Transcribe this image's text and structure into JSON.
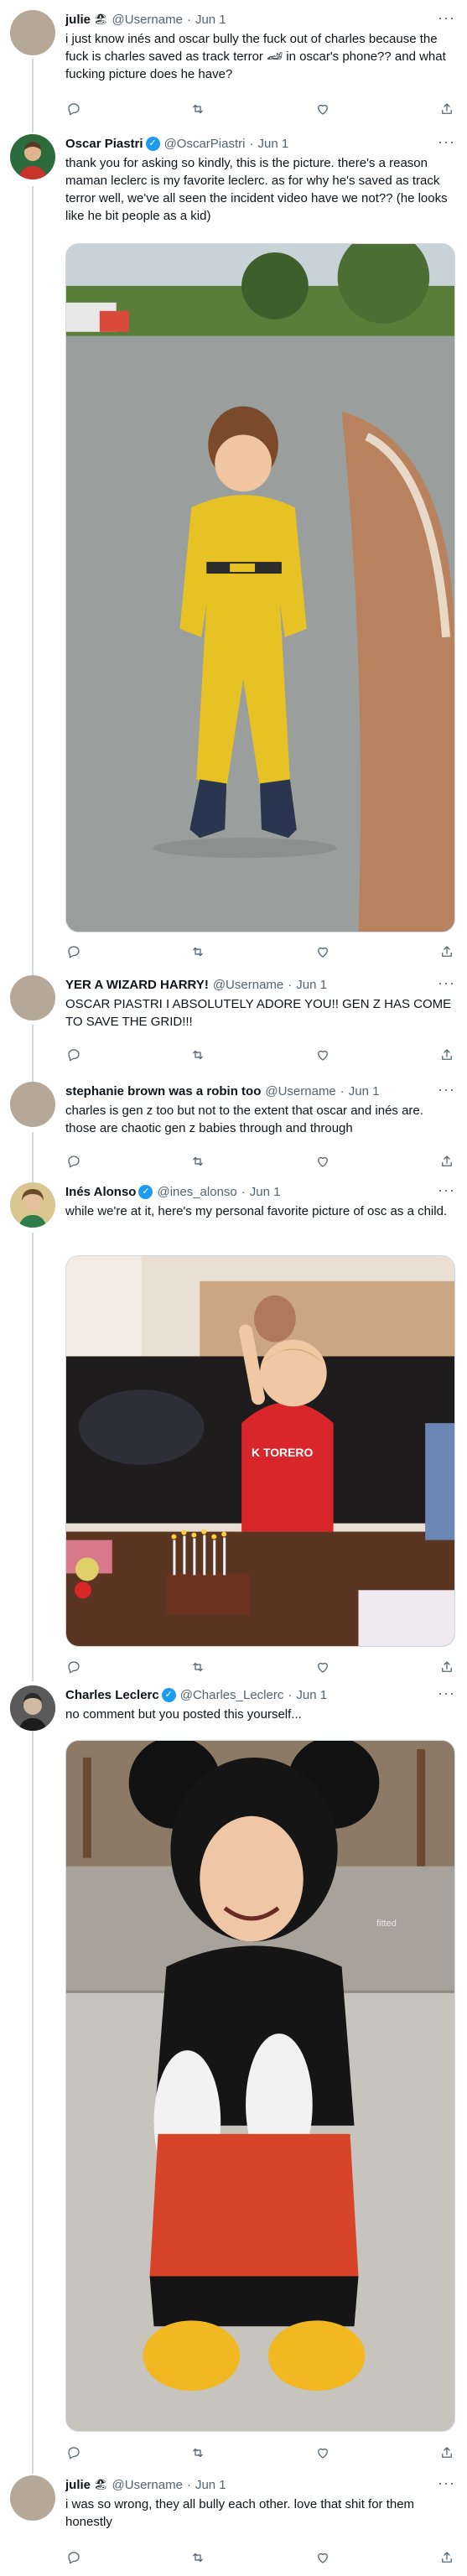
{
  "tweets": [
    {
      "name": "julie",
      "emoji": "🏖",
      "handle": "@Username",
      "sep": "·",
      "date": "Jun 1",
      "text": "i just know inés and oscar bully the fuck out of charles because the fuck is charles saved as track terror 🏎 in oscar's phone?? and what fucking picture does he have?",
      "avatar": "plain-avatar"
    },
    {
      "name": "Oscar Piastri",
      "verified": true,
      "handle": "@OscarPiastri",
      "sep": "·",
      "date": "Jun 1",
      "text": "thank you for asking so kindly, this is the picture. there's a reason maman leclerc is my favorite leclerc. as for why he's saved as track terror well, we've all seen the incident video have we not?? (he looks like he bit people as a kid)",
      "avatar": "oscar-avatar",
      "media": "photo-child-yellow-racing-suit"
    },
    {
      "name": "YER A WIZARD HARRY!",
      "handle": "@Username",
      "sep": "·",
      "date": "Jun 1",
      "text": "OSCAR PIASTRI I ABSOLUTELY ADORE YOU!! GEN Z HAS COME TO SAVE THE GRID!!!",
      "avatar": "plain-avatar"
    },
    {
      "name": "stephanie brown was a robin too",
      "handle": "@Username",
      "sep": "·",
      "date": "Jun 1",
      "text": "charles is gen z too but not to the extent that oscar and inés are. those are chaotic gen z babies through and through",
      "avatar": "plain-avatar"
    },
    {
      "name": "Inés Alonso",
      "verified": true,
      "handle": "@ines_alonso",
      "sep": "·",
      "date": "Jun 1",
      "text": "while we're at it, here's my personal favorite picture of osc as a child.",
      "avatar": "ines-avatar",
      "media": "photo-birthday-cake"
    },
    {
      "name": "Charles Leclerc",
      "verified": true,
      "handle": "@Charles_Leclerc",
      "sep": "·",
      "date": "Jun 1",
      "text": "no comment but you posted this yourself...",
      "avatar": "charles-avatar",
      "media": "photo-mickey-costume",
      "watermark": "fitted"
    },
    {
      "name": "julie",
      "emoji": "🏖",
      "handle": "@Username",
      "sep": "·",
      "date": "Jun 1",
      "text": "i was so wrong, they all bully each other. love that shit for them honestly",
      "avatar": "plain-avatar"
    }
  ],
  "more_label": "···",
  "verified_glyph": "✓",
  "action_icons": [
    "reply-icon",
    "retweet-icon",
    "like-icon",
    "share-icon"
  ]
}
